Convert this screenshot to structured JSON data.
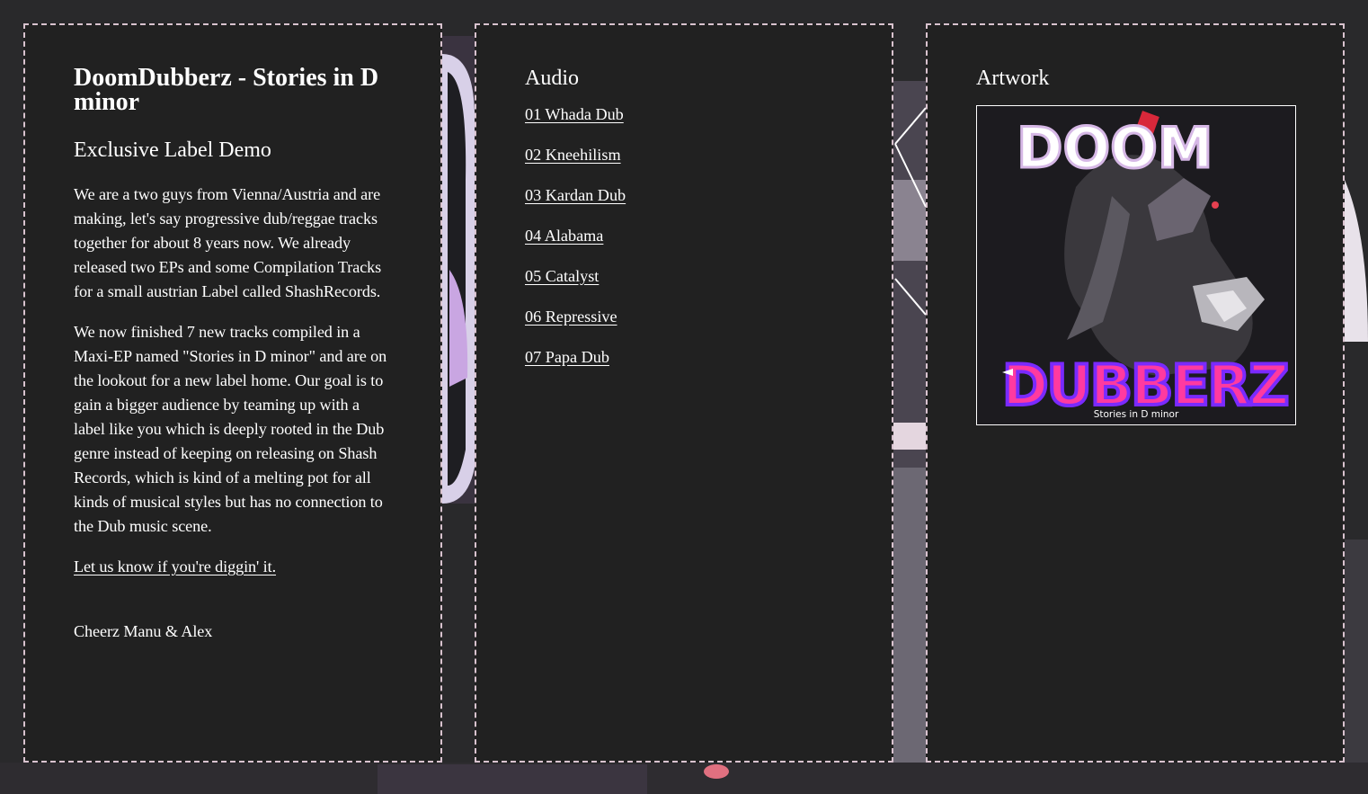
{
  "intro": {
    "title": "DoomDubberz - Stories in D minor",
    "subtitle": "Exclusive Label Demo",
    "paragraph_1": "We are a two guys from Vienna/Austria and are making, let's say progressive dub/reggae tracks together for about 8 years now. We already released two EPs and some Compilation Tracks for a small austrian Label called ShashRecords.",
    "paragraph_2": "We now finished 7 new tracks compiled in a Maxi-EP named \"Stories in D minor\" and are on the lookout for a new label home. Our goal is to gain a bigger audience by teaming up with a label like you which is deeply rooted in the Dub genre instead of keeping on releasing on Shash Records, which is kind of a melting pot for all kinds of musical styles but has no connection to the Dub music scene.",
    "cta_link": "Let us know if you're diggin' it.",
    "signature": "Cheerz Manu & Alex"
  },
  "audio": {
    "title": "Audio",
    "tracks": [
      "01 Whada Dub",
      "02 Kneehilism",
      "03 Kardan Dub",
      "04 Alabama",
      "05 Catalyst",
      "06 Repressive",
      "07 Papa Dub"
    ]
  },
  "artwork": {
    "title": "Artwork",
    "caption": "Stories in D minor",
    "logo_text": "DUBBERZ",
    "logo_top": "DOOM"
  },
  "colors": {
    "panel_bg": "#212121",
    "border": "#d9c3cf",
    "text": "#ffffff"
  }
}
